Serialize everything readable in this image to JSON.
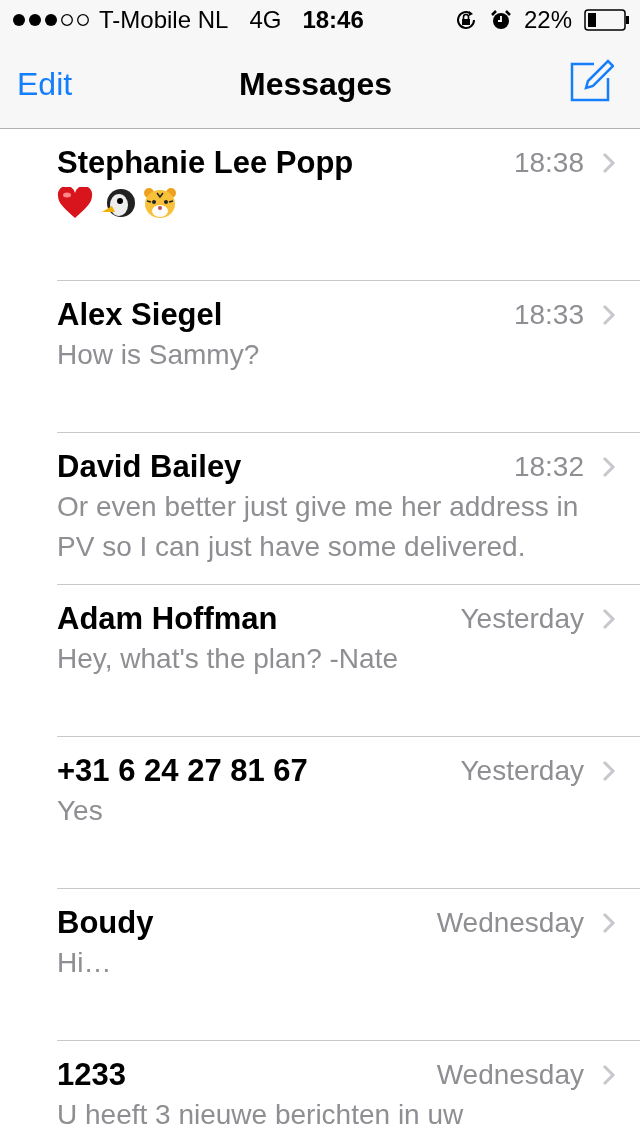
{
  "status_bar": {
    "carrier": "T-Mobile NL",
    "network": "4G",
    "time": "18:46",
    "battery_percent": "22%"
  },
  "nav_bar": {
    "edit": "Edit",
    "title": "Messages"
  },
  "conversations": [
    {
      "name": "Stephanie Lee Popp",
      "time": "18:38",
      "kind": "emoji"
    },
    {
      "name": "Alex Siegel",
      "time": "18:33",
      "kind": "text",
      "preview": "How is Sammy?"
    },
    {
      "name": "David Bailey",
      "time": "18:32",
      "kind": "text",
      "preview": "Or even better just give me her address in PV so I can just have some delivered."
    },
    {
      "name": "Adam Hoffman",
      "time": "Yesterday",
      "kind": "text",
      "preview": "Hey, what's the plan? -Nate"
    },
    {
      "name": "+31 6 24 27 81 67",
      "time": "Yesterday",
      "kind": "text",
      "preview": "Yes"
    },
    {
      "name": "Boudy",
      "time": "Wednesday",
      "kind": "text",
      "preview": "Hi…"
    },
    {
      "name": "1233",
      "time": "Wednesday",
      "kind": "text",
      "preview": "U heeft 3 nieuwe berichten in uw"
    }
  ]
}
